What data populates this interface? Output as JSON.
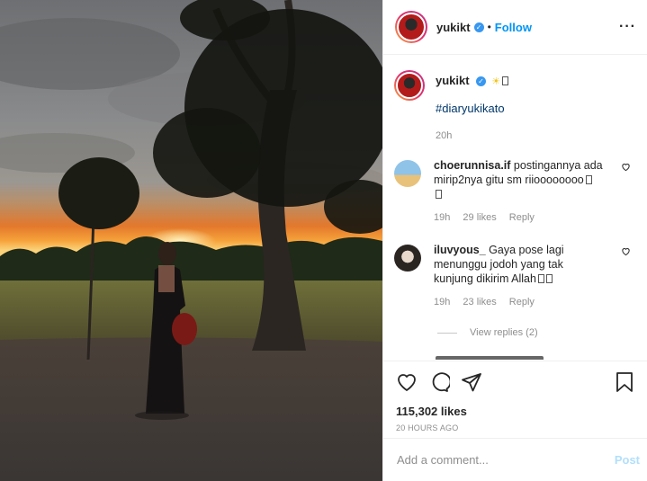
{
  "header": {
    "username": "yukikt",
    "separator": "•",
    "follow_label": "Follow",
    "more_icon": "more-horizontal-icon"
  },
  "caption": {
    "username": "yukikt",
    "hashtag": "#diaryukikato",
    "time": "20h"
  },
  "comments": [
    {
      "username": "choerunnisa.if",
      "text": "postingannya ada mirip2nya gitu sm riioooooooo",
      "time": "19h",
      "likes": "29 likes",
      "reply": "Reply"
    },
    {
      "username": "iluvyous_",
      "text": "Gaya pose lagi menunggu jodoh yang tak kunjung dikirim Allah",
      "time": "19h",
      "likes": "23 likes",
      "reply": "Reply"
    }
  ],
  "view_replies": "View replies (2)",
  "actions": {
    "likes": "115,302 likes",
    "posted_ago": "20 HOURS AGO"
  },
  "add_comment": {
    "placeholder": "Add a comment...",
    "post_label": "Post"
  },
  "colors": {
    "link_blue": "#0095f6",
    "hashtag_blue": "#00376b",
    "muted": "#8e8e8e",
    "post_disabled": "#b2dffc"
  }
}
